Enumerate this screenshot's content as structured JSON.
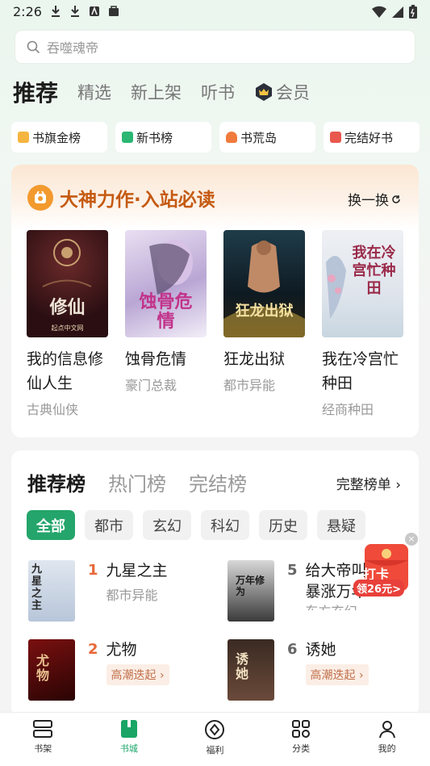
{
  "status": {
    "time": "2:26"
  },
  "search": {
    "placeholder": "吞噬魂帝"
  },
  "top_tabs": [
    "推荐",
    "精选",
    "新上架",
    "听书",
    "会员"
  ],
  "chips": [
    {
      "label": "书旗金榜",
      "color": "#f2a53a"
    },
    {
      "label": "新书榜",
      "color": "#2bb673"
    },
    {
      "label": "书荒岛",
      "color": "#f07a3c"
    },
    {
      "label": "完结好书",
      "color": "#e8584d"
    }
  ],
  "feature": {
    "title": "大神力作·入站必读",
    "swap_label": "换一换",
    "books": [
      {
        "name": "我的信息修仙人生",
        "genre": "古典仙侠",
        "cover_text": "修仙",
        "cover_publisher": "起点中文网"
      },
      {
        "name": "蚀骨危情",
        "genre": "豪门总裁",
        "cover_text": "蚀骨危情"
      },
      {
        "name": "狂龙出狱",
        "genre": "都市异能",
        "cover_text": "狂龙出狱"
      },
      {
        "name": "我在冷宫忙种田",
        "genre": "经商种田",
        "cover_text": "我在冷宫忙种田"
      }
    ]
  },
  "ranking": {
    "tabs": [
      "推荐榜",
      "热门榜",
      "完结榜"
    ],
    "full_list_label": "完整榜单",
    "categories": [
      "全部",
      "都市",
      "玄幻",
      "科幻",
      "历史",
      "悬疑"
    ],
    "items": [
      {
        "rank": "1",
        "name": "九星之主",
        "sub": "都市异能",
        "cover_text": "九星之主"
      },
      {
        "rank": "2",
        "name": "尤物",
        "tag": "高潮迭起",
        "cover_text": "尤物"
      },
      {
        "rank": "5",
        "name": "给大帝叫...我暴涨万年...",
        "sub": "东方玄幻",
        "cover_text": "万年修为"
      },
      {
        "rank": "6",
        "name": "诱她",
        "tag": "高潮迭起",
        "cover_text": "诱她"
      }
    ]
  },
  "float_badge": {
    "line1": "打卡",
    "line2": "领26元>"
  },
  "bottom_nav": [
    "书架",
    "书城",
    "福利",
    "分类",
    "我的"
  ]
}
